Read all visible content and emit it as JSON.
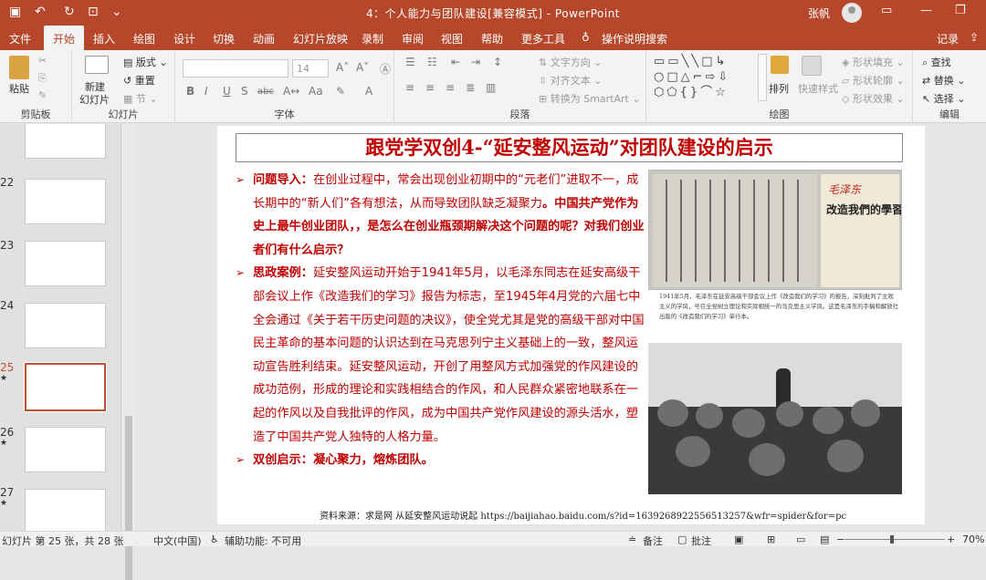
{
  "window": {
    "title": "4：个人能力与团队建设[兼容模式] - PowerPoint",
    "user": "张帆"
  },
  "tabs": [
    {
      "label": "文件"
    },
    {
      "label": "开始"
    },
    {
      "label": "插入"
    },
    {
      "label": "绘图"
    },
    {
      "label": "设计"
    },
    {
      "label": "切换"
    },
    {
      "label": "动画"
    },
    {
      "label": "幻灯片放映"
    },
    {
      "label": "录制"
    },
    {
      "label": "审阅"
    },
    {
      "label": "视图"
    },
    {
      "label": "帮助"
    },
    {
      "label": "更多工具"
    },
    {
      "label": "操作说明搜索"
    },
    {
      "label": "记录"
    }
  ],
  "ribbon": {
    "clipboard": {
      "paste": "粘贴",
      "group": "剪贴板"
    },
    "slides": {
      "new_slide_1": "新建",
      "new_slide_2": "幻灯片",
      "layout": "版式",
      "reset": "重置",
      "section": "节",
      "group": "幻灯片"
    },
    "font": {
      "size": "14",
      "group": "字体"
    },
    "paragraph": {
      "text_direction": "文字方向",
      "align_text": "对齐文本",
      "smartart": "转换为 SmartArt",
      "group": "段落"
    },
    "drawing": {
      "arrange": "排列",
      "quick_styles": "快速样式",
      "fill": "形状填充",
      "outline": "形状轮廓",
      "effects": "形状效果",
      "group": "绘图"
    },
    "editing": {
      "find": "查找",
      "replace": "替换",
      "select": "选择",
      "group": "编辑"
    }
  },
  "thumbnails": [
    {
      "num": "22"
    },
    {
      "num": "23"
    },
    {
      "num": "24"
    },
    {
      "num": "25",
      "selected": true
    },
    {
      "num": "26"
    },
    {
      "num": "27"
    }
  ],
  "slide": {
    "title": "跟党学双创4-“延安整风运动”对团队建设的启示",
    "p1_head": "问题导入：",
    "p1_text": "在创业过程中，常会出现创业初期中的“元老们”进取不一，成长期中的“新人们”各有想法，从而导致团队缺乏凝聚力",
    "p1_bold": "。中国共产党作为史上最牛创业团队，，是怎么在创业瓶颈期解决这个问题的呢？对我们创业者们有什么启示？",
    "p2_head": "思政案例：",
    "p2_text": "延安整风运动开始于1941年5月，以毛泽东同志在延安高级干部会议上作《改造我们的学习》报告为标志，至1945年4月党的六届七中全会通过《关于若干历史问题的决议》，使全党尤其是党的高级干部对中国民主革命的基本问题的认识达到在马克思列宁主义基础上的一致，整风运动宣告胜利结束。延安整风运动，开创了用整风方式加强党的作风建设的成功范例，形成的理论和实践相结合的作风，和人民群众紧密地联系在一起的作风以及自我批评的作风，成为中国共产党作风建设的源头活水，塑造了中国共产党人独特的人格力量。",
    "p3_head": "双创启示：",
    "p3_text": "凝心聚力，熔炼团队。",
    "book_title": "改造我們的學習",
    "book_signature": "毛泽东",
    "caption": "1941年5月，毛泽东在延安高级干部会议上作《改造我们的学习》的报告，深刻批判了主观主义的学风，号召全党树立理论和实际相统一的马克思主义学风。这是毛泽东的手稿和解放社出版的《改造我们的学习》单行本。",
    "source": "资料来源：求是网 从延安整风运动说起 https://baijiahao.baidu.com/s?id=1639268922556513257&wfr=spider&for=pc"
  },
  "status": {
    "slide_info": "幻灯片 第 25 张，共 28 张",
    "language": "中文(中国)",
    "accessibility": "辅助功能: 不可用",
    "notes": "备注",
    "comments": "批注",
    "zoom": "70%"
  },
  "colors": {
    "accent": "#b7472a",
    "slide_text": "#c00000"
  }
}
